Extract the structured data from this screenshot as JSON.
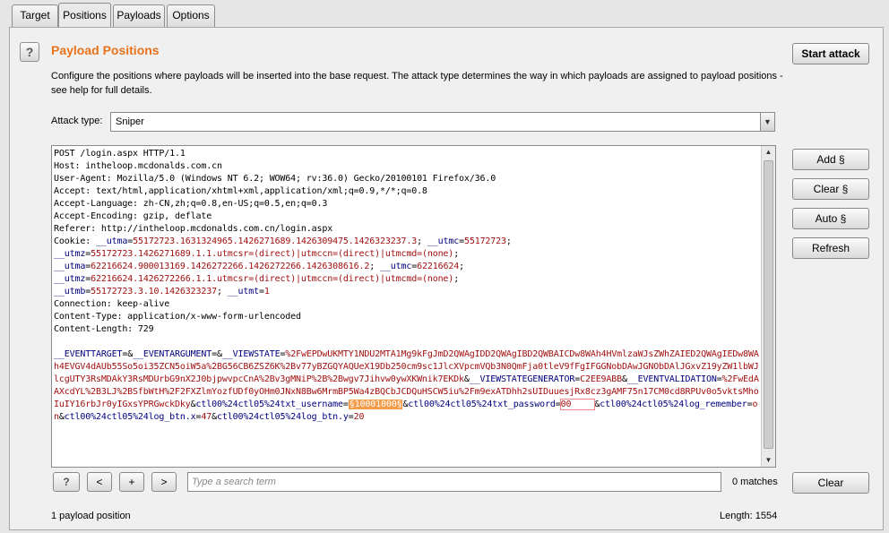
{
  "tabs": [
    {
      "label": "Target"
    },
    {
      "label": "Positions"
    },
    {
      "label": "Payloads"
    },
    {
      "label": "Options"
    }
  ],
  "panel": {
    "help_icon": "?",
    "title": "Payload Positions",
    "description": "Configure the positions where payloads will be inserted into the base request. The attack type determines the way in which payloads are assigned to payload positions - see help for full details.",
    "start_attack_label": "Start attack",
    "attack_type_label": "Attack type:",
    "attack_type_value": "Sniper",
    "side_buttons": {
      "add": "Add §",
      "clear": "Clear §",
      "auto": "Auto §",
      "refresh": "Refresh"
    }
  },
  "request": {
    "headers": [
      "POST /login.aspx HTTP/1.1",
      "Host: intheloop.mcdonalds.com.cn",
      "User-Agent: Mozilla/5.0 (Windows NT 6.2; WOW64; rv:36.0) Gecko/20100101 Firefox/36.0",
      "Accept: text/html,application/xhtml+xml,application/xml;q=0.9,*/*;q=0.8",
      "Accept-Language: zh-CN,zh;q=0.8,en-US;q=0.5,en;q=0.3",
      "Accept-Encoding: gzip, deflate",
      "Referer: http://intheloop.mcdonalds.com.cn/login.aspx"
    ],
    "cookie_prefix": "Cookie: ",
    "cookies": [
      {
        "name": "__utma",
        "value": "55172723.1631324965.1426271689.1426309475.1426323237.3",
        "sep": "; "
      },
      {
        "name": "__utmc",
        "value": "55172723",
        "sep": ";\n"
      },
      {
        "name": "__utmz",
        "value": "55172723.1426271689.1.1.utmcsr=(direct)|utmccn=(direct)|utmcmd=(none)",
        "sep": ";\n"
      },
      {
        "name": "__utma",
        "value": "62216624.900013169.1426272266.1426272266.1426308616.2",
        "sep": "; "
      },
      {
        "name": "__utmc",
        "value": "62216624",
        "sep": ";\n"
      },
      {
        "name": "__utmz",
        "value": "62216624.1426272266.1.1.utmcsr=(direct)|utmccn=(direct)|utmcmd=(none)",
        "sep": ";\n"
      },
      {
        "name": "__utmb",
        "value": "55172723.3.10.1426323237",
        "sep": "; "
      },
      {
        "name": "__utmt",
        "value": "1",
        "sep": ""
      }
    ],
    "after_cookie": [
      "Connection: keep-alive",
      "Content-Type: application/x-www-form-urlencoded",
      "Content-Length: 729"
    ],
    "body_parts": [
      {
        "name": "__EVENTTARGET",
        "value": ""
      },
      {
        "name": "__EVENTARGUMENT",
        "value": ""
      },
      {
        "name": "__VIEWSTATE",
        "value": "%2FwEPDwUKMTY1NDU2MTA1Mg9kFgJmD2QWAgIDD2QWAgIBD2QWBAICDw8WAh4HVmlzaWJsZWhZAIED2QWAgIEDw8WAh4EVGV4dAUb55So5oi35ZCN5oiW5a%2BG56CB6ZSZ6K%2Bv77yBZGQYAQUeX19Db250cm9sc1JlcXVpcmVQb3N0QmFja0tleV9fFgIFGGNobDAwJGNObDAlJGxvZ19yZW1lbWJlcgUTY3RsMDAkY3RsMDUrbG9nX2J0bjpwvpcCnA%2Bv3gMNiP%2B%2Bwgv7Jihvw0ywXKWnik7EKDk"
      },
      {
        "name": "__VIEWSTATEGENERATOR",
        "value": "C2EE9ABB"
      },
      {
        "name": "__EVENTVALIDATION",
        "value": "%2FwEdAAXcdYL%2B3LJ%2BSfbWtH%2F2FXZlmYozfUDf0yOHm0JNxN8Bw6MrmBP5Wa4zBQCbJCDQuHSCW5iu%2Fm9exATDhh2sUIDuuesjRx8cz3gAMF75n17CM0cd8RPUv0o5vktsMhoIuIY16rbJr0yIGxsYPRGwckDky"
      },
      {
        "name": "ctl00%24ctl05%24txt_username",
        "value": "10001000",
        "marked": true
      },
      {
        "name": "ctl00%24ctl05%24txt_password",
        "value": "00",
        "redacted": true
      },
      {
        "name": "ctl00%24ctl05%24log_remember",
        "value": "on"
      },
      {
        "name": "ctl00%24ctl05%24log_btn.x",
        "value": "47"
      },
      {
        "name": "ctl00%24ctl05%24log_btn.y",
        "value": "20"
      }
    ],
    "marker": "§"
  },
  "bottom": {
    "help_icon": "?",
    "prev_label": "<",
    "add_label": "+",
    "next_label": ">",
    "search_placeholder": "Type a search term",
    "matches": "0 matches",
    "clear_label": "Clear"
  },
  "status": {
    "payload_positions": "1 payload position",
    "length": "Length: 1554"
  },
  "colors": {
    "title": "#e8731c",
    "param_name": "#00007f",
    "param_value": "#a11010",
    "payload_marker": "#f39c4b"
  }
}
